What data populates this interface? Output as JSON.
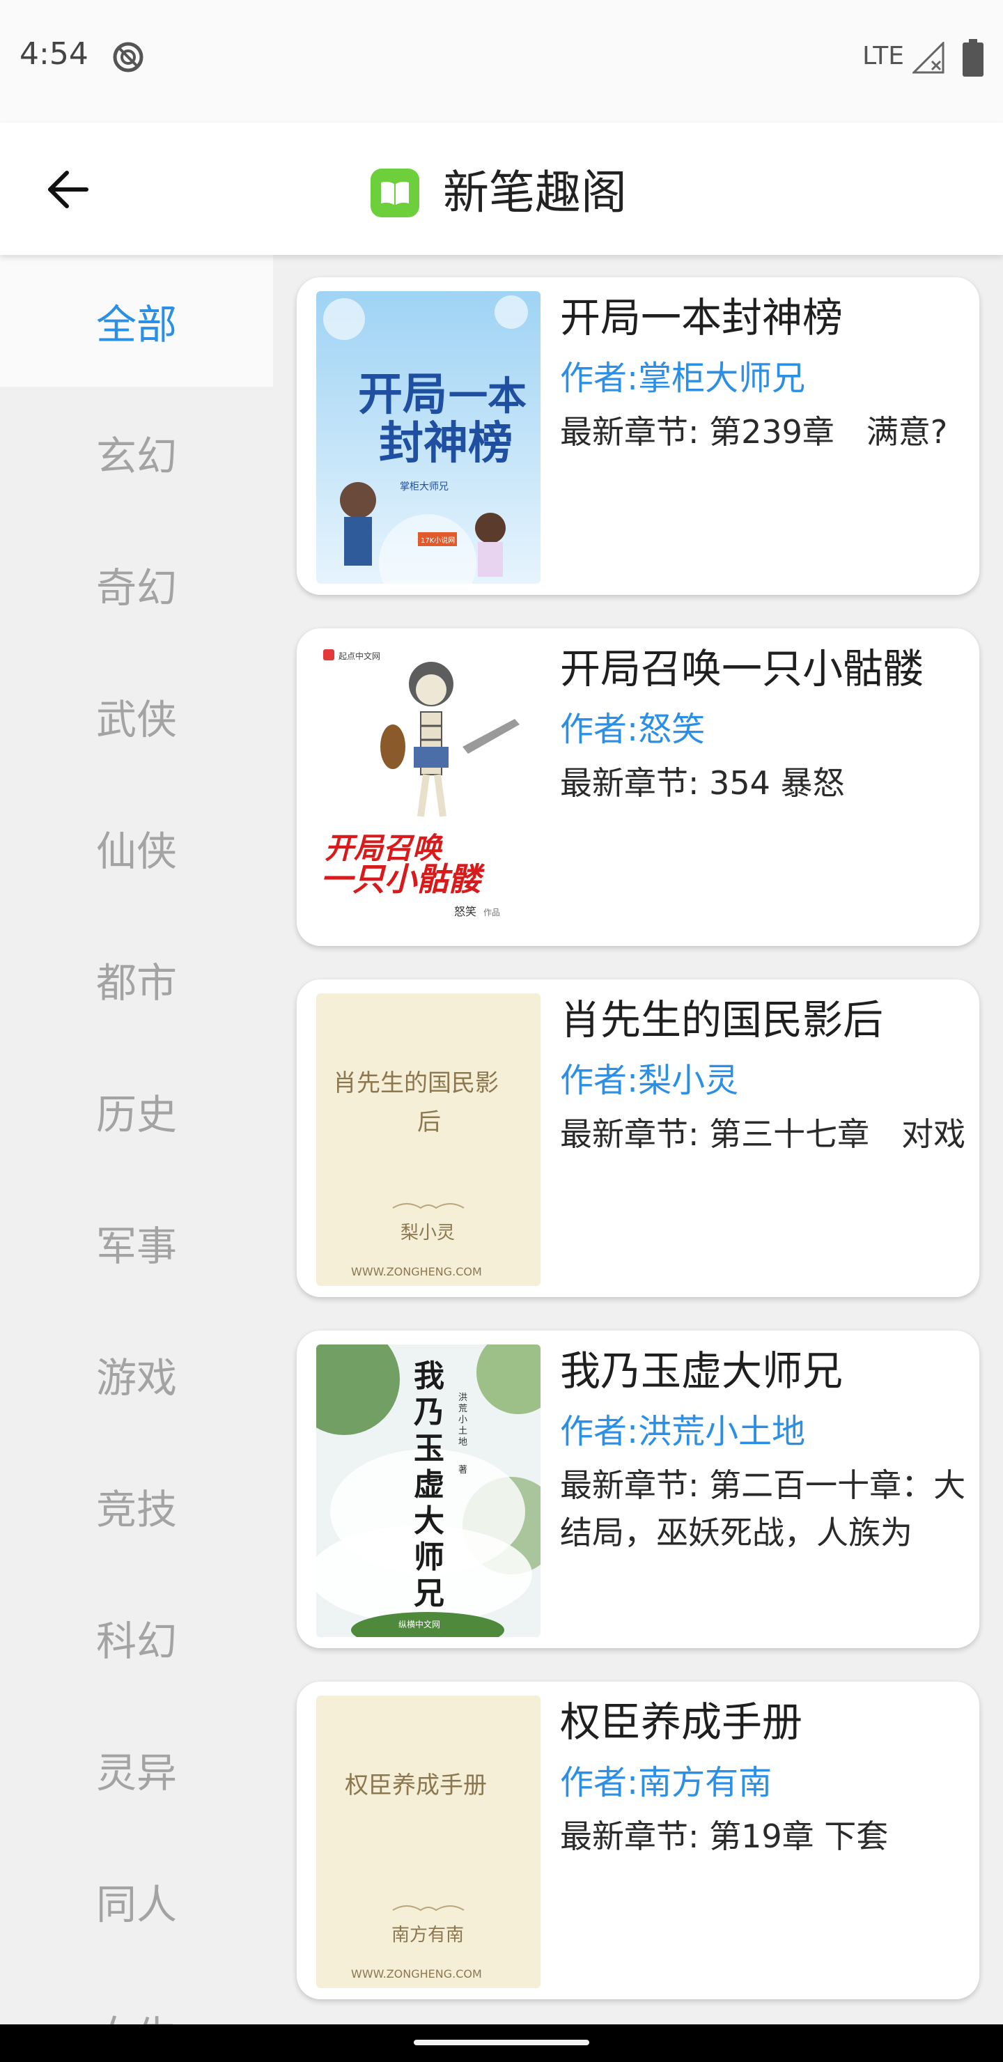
{
  "status_bar": {
    "time": "4:54",
    "network": "LTE",
    "icons": [
      "do-not-disturb-icon",
      "signal-icon",
      "battery-icon"
    ]
  },
  "toolbar": {
    "title": "新笔趣阁",
    "back_icon": "arrow-left-icon",
    "logo_icon": "book-icon",
    "logo_color": "#6dcf3b"
  },
  "categories": [
    {
      "label": "全部",
      "active": true
    },
    {
      "label": "玄幻"
    },
    {
      "label": "奇幻"
    },
    {
      "label": "武侠"
    },
    {
      "label": "仙侠"
    },
    {
      "label": "都市"
    },
    {
      "label": "历史"
    },
    {
      "label": "军事"
    },
    {
      "label": "游戏"
    },
    {
      "label": "竞技"
    },
    {
      "label": "科幻"
    },
    {
      "label": "灵异"
    },
    {
      "label": "同人"
    },
    {
      "label": "女生"
    }
  ],
  "books": [
    {
      "title": "开局一本封神榜",
      "author": "作者:掌柜大师兄",
      "latest": "最新章节: 第239章　满意?",
      "cover": {
        "title": "开局一本封神榜",
        "author": "掌柜大师兄",
        "badge": "17K小说网"
      }
    },
    {
      "title": "开局召唤一只小骷髅",
      "author": "作者:怒笑",
      "latest": "最新章节: 354 暴怒",
      "cover": {
        "title": "开局召唤一只小骷髅",
        "author": "怒笑",
        "publisher": "起点中文网",
        "suffix": "作品"
      }
    },
    {
      "title": "肖先生的国民影后",
      "author": "作者:梨小灵",
      "latest": "最新章节: 第三十七章　对戏",
      "cover": {
        "title": "肖先生的国民影后",
        "author": "梨小灵",
        "site": "WWW.ZONGHENG.COM"
      }
    },
    {
      "title": "我乃玉虚大师兄",
      "author": "作者:洪荒小土地",
      "latest": "最新章节: 第二百一十章：大结局，巫妖死战，人族为",
      "cover": {
        "title": "我乃玉虚大师兄",
        "author": "洪荒小土地",
        "suffix": "著",
        "badge": "纵横中文网"
      }
    },
    {
      "title": "权臣养成手册",
      "author": "作者:南方有南",
      "latest": "最新章节: 第19章 下套",
      "cover": {
        "title": "权臣养成手册",
        "author": "南方有南",
        "site": "WWW.ZONGHENG.COM"
      }
    }
  ],
  "colors": {
    "accent": "#2b8fe6",
    "inactive": "#a3a3a3",
    "background": "#f0f0f0"
  }
}
